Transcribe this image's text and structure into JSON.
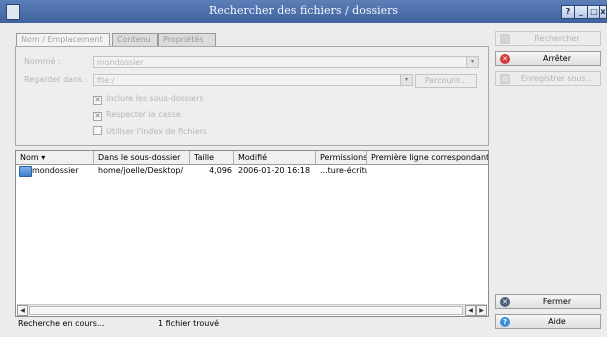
{
  "window": {
    "title": "Rechercher des fichiers / dossiers",
    "controls": {
      "help": "?",
      "minimize": "_",
      "maximize": "□",
      "close": "x"
    }
  },
  "tabs": [
    {
      "label": "Nom / Emplacement"
    },
    {
      "label": "Contenu"
    },
    {
      "label": "Propriétés"
    }
  ],
  "form": {
    "name_label": "Nommé :",
    "name_value": "mondossier",
    "look_in_label": "Regarder dans :",
    "look_in_value": "file:/",
    "browse_label": "Parcourir...",
    "include_subfolders_label": "Inclure les sous-dossiers",
    "case_sensitive_label": "Respecter la casse",
    "use_index_label": "Utiliser l'index de fichiers",
    "include_subfolders_checked": true,
    "case_sensitive_checked": true,
    "use_index_checked": false
  },
  "results": {
    "columns": [
      "Nom",
      "Dans le sous-dossier",
      "Taille",
      "Modifié",
      "Permissions",
      "Première ligne correspondante"
    ],
    "rows": [
      {
        "name": "mondossier",
        "folder": "home/joelle/Desktop/",
        "size": "4,096",
        "modified": "2006-01-20 16:18",
        "permissions": "...ture-écriture",
        "first_line": ""
      }
    ]
  },
  "status": {
    "left": "Recherche en cours...",
    "count": "1 fichier trouvé"
  },
  "buttons": {
    "search": "Rechercher",
    "stop": "Arrêter",
    "save": "Enregistrer sous...",
    "close": "Fermer",
    "help": "Aide"
  },
  "colors": {
    "titlebar": "#4a6ba8",
    "stop_icon": "#d33b3b",
    "help_icon": "#3b8fd8"
  }
}
